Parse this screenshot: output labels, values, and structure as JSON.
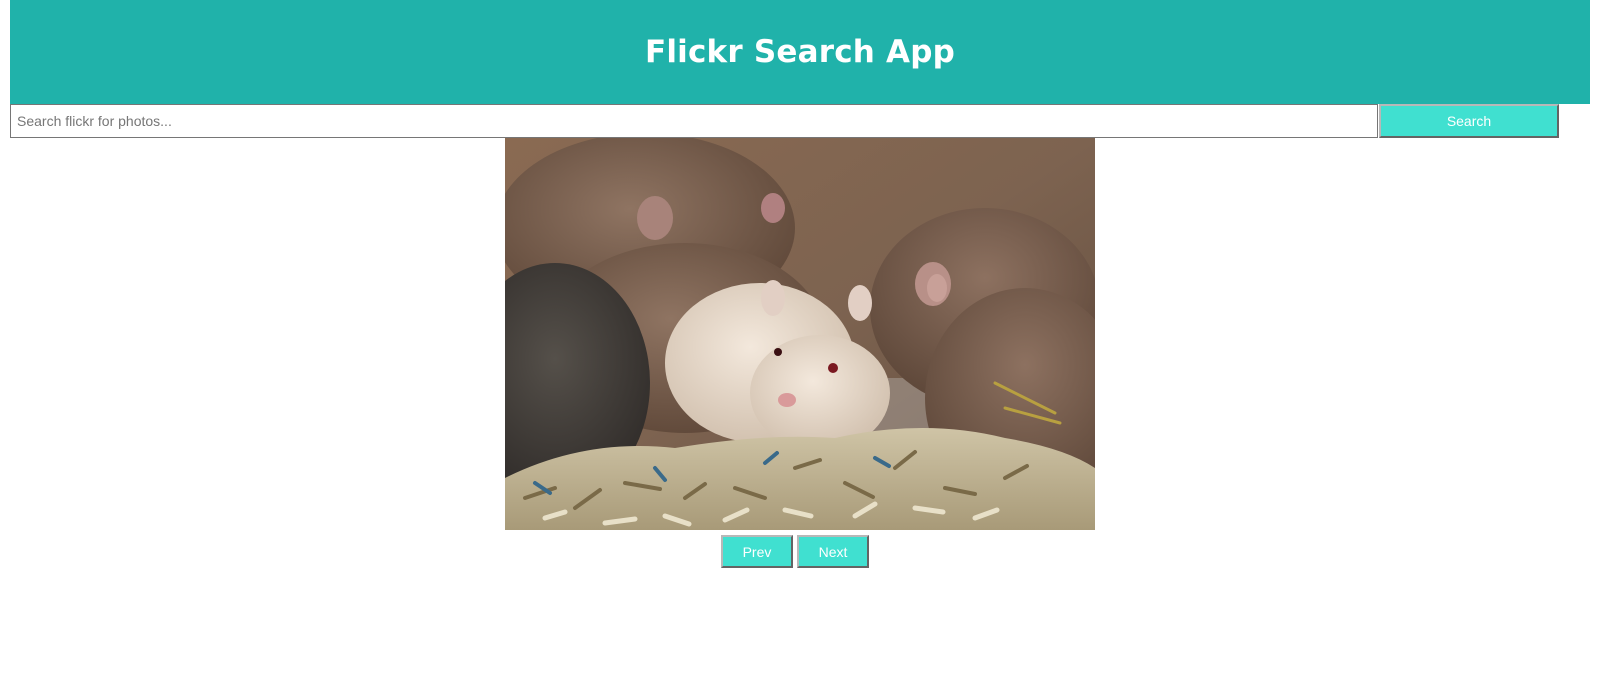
{
  "header": {
    "title": "Flickr Search App"
  },
  "search": {
    "placeholder": "Search flickr for photos...",
    "value": "",
    "button_label": "Search"
  },
  "photo": {
    "subject": "hamsters-in-bedding"
  },
  "pager": {
    "prev_label": "Prev",
    "next_label": "Next"
  },
  "colors": {
    "header_bg": "#20b2aa",
    "button_bg": "#40e0d0",
    "button_text": "#ffffff"
  }
}
